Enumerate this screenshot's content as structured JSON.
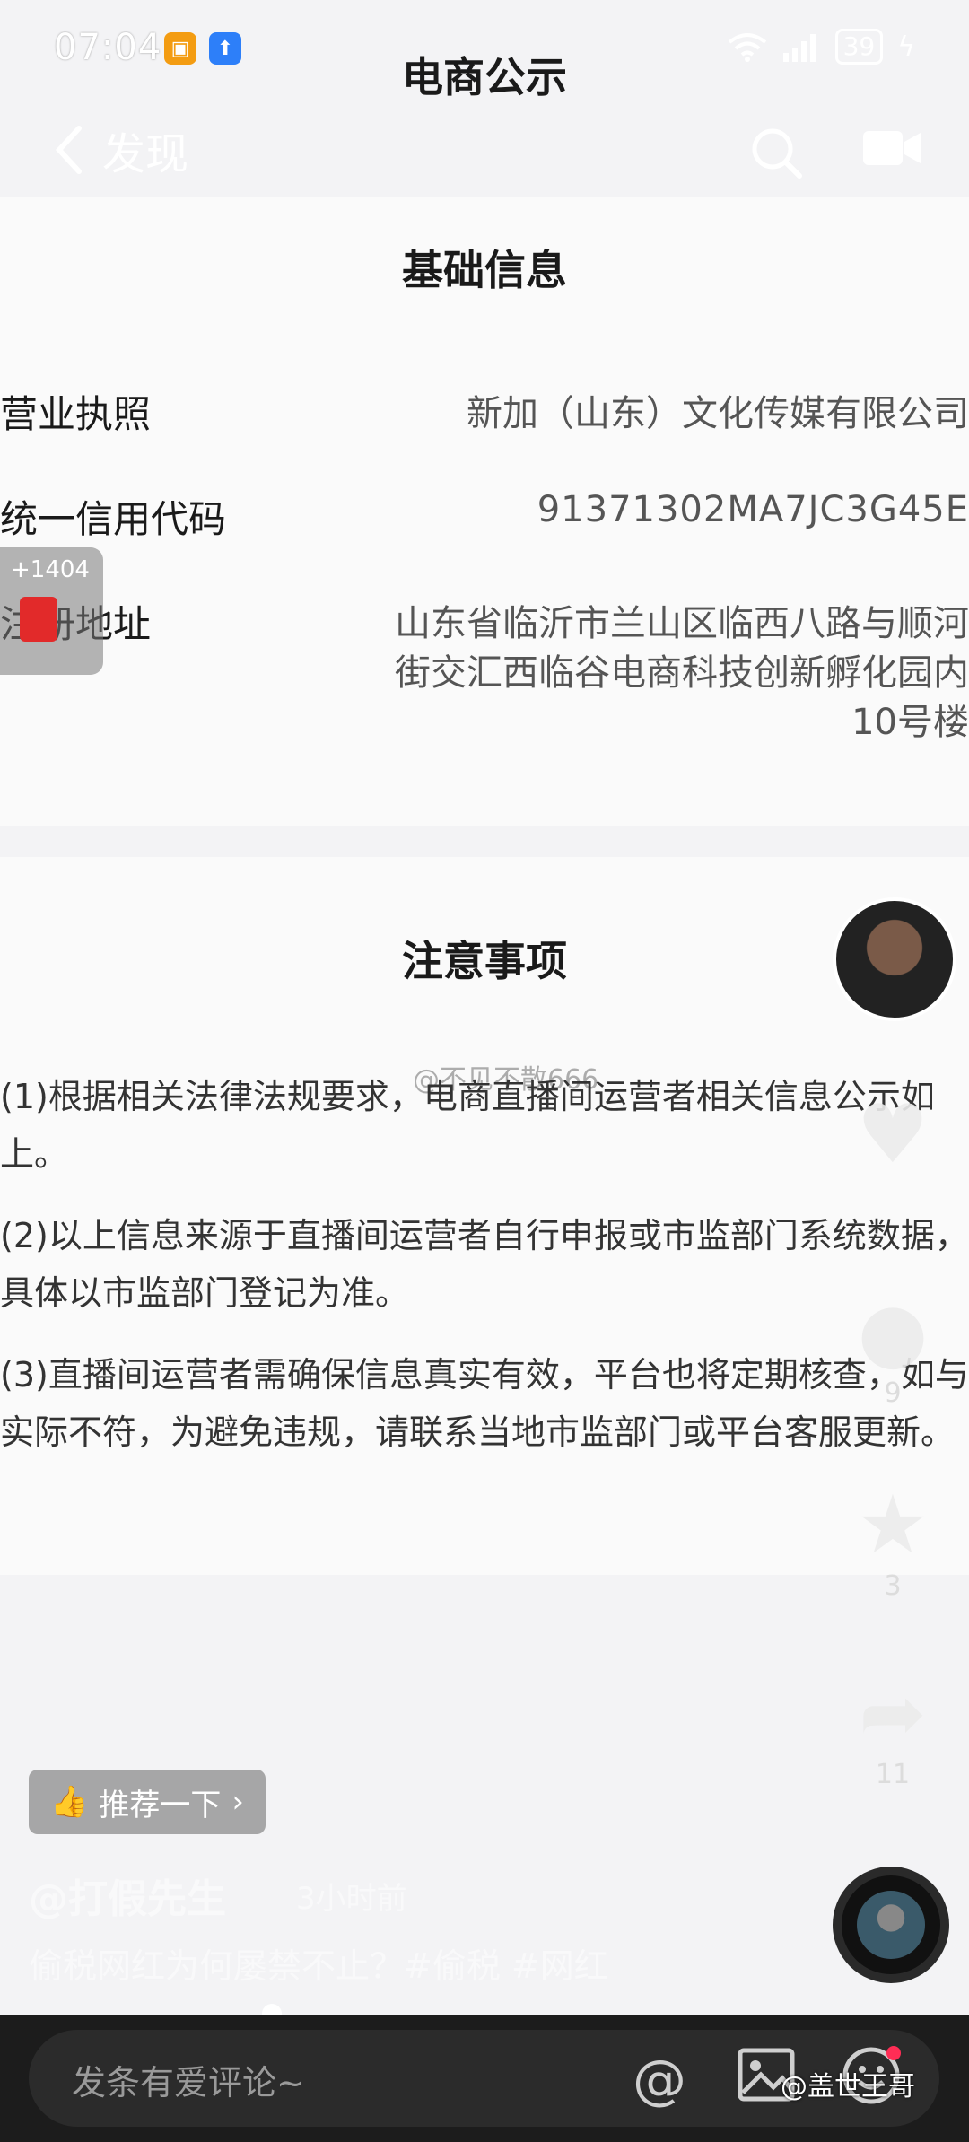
{
  "status_bar": {
    "time": "07:04",
    "battery": "39"
  },
  "header": {
    "title": "电商公示",
    "back_label": "发现"
  },
  "basic_info": {
    "title": "基础信息",
    "rows": [
      {
        "label": "营业执照",
        "value": "新加（山东）文化传媒有限公司"
      },
      {
        "label": "统一信用代码",
        "value": "91371302MA7JC3G45E"
      },
      {
        "label": "注册地址",
        "value_lines": [
          "山东省临沂市兰山区临西八路与顺河",
          "街交汇西临谷电商科技创新孵化园内",
          "10号楼"
        ]
      }
    ]
  },
  "notices": {
    "title": "注意事项",
    "items": [
      "(1)根据相关法律法规要求，电商直播间运营者相关信息公示如上。",
      "(2)以上信息来源于直播间运营者自行申报或市监部门系统数据，具体以市监部门登记为准。",
      "(3)直播间运营者需确保信息真实有效，平台也将定期核查，如与实际不符，为避免违规，请联系当地市监部门或平台客服更新。"
    ]
  },
  "red_packet": {
    "count": "+1404"
  },
  "right_rail": {
    "comments": "9",
    "favorites": "3",
    "shares": "11"
  },
  "bottom": {
    "recommend_label": "推荐一下",
    "author": "@打假先生",
    "time_ago": "3小时前",
    "caption": "偷税网红为何屡禁不止？#偷税 #网红",
    "comment_placeholder": "发条有爱评论~",
    "watermark": "@盖世王哥",
    "overlay_handle": "@不见不散666"
  },
  "colors": {
    "accent_red": "#e22a2a",
    "bottom_bar": "#1c1c1c"
  }
}
